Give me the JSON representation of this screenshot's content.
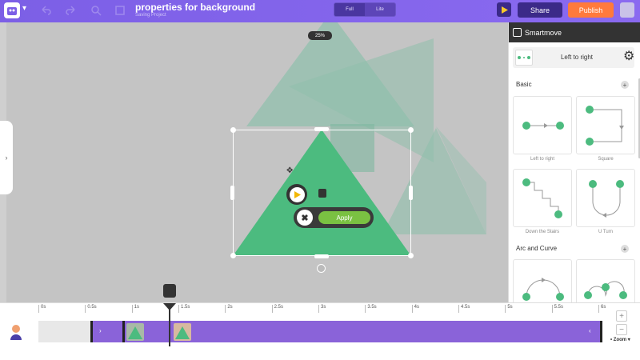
{
  "header": {
    "project_title": "properties for background",
    "project_subtitle": "Saving Project",
    "modes": [
      "Full",
      "Lite"
    ],
    "share_label": "Share",
    "publish_label": "Publish"
  },
  "canvas": {
    "zoom_level": "25%",
    "apply_label": "Apply"
  },
  "panel": {
    "title": "Smartmove",
    "current_animation": "Left to right",
    "sections": [
      {
        "title": "Basic",
        "items": [
          "Left to right",
          "Square",
          "Down the Stairs",
          "U Turn"
        ]
      },
      {
        "title": "Arc and Curve",
        "items": []
      }
    ]
  },
  "timeline": {
    "ticks": [
      "0s",
      "0.5s",
      "1s",
      "1.5s",
      "2s",
      "2.5s",
      "3s",
      "3.5s",
      "4s",
      "4.5s",
      "5s",
      "5.5s",
      "6s"
    ],
    "zoom_label": "Zoom"
  },
  "colors": {
    "brand_purple": "#7c5fe6",
    "publish_orange": "#ff7a3c",
    "shape_green": "#4cbb7f",
    "apply_green": "#7ac142",
    "track_purple": "#8a63d9"
  }
}
